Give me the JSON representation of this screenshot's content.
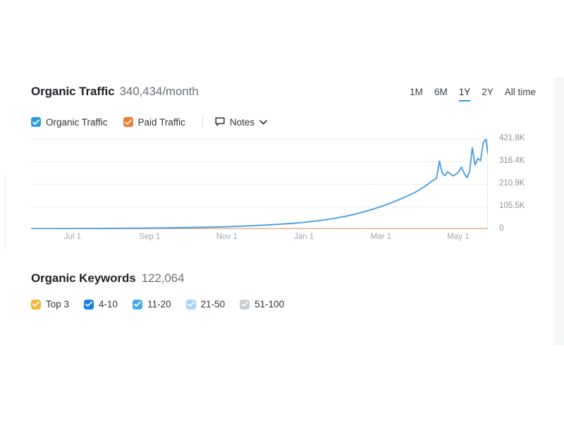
{
  "header": {
    "title": "Organic Traffic",
    "value": "340,434/month"
  },
  "time_ranges": [
    {
      "label": "1M",
      "active": false
    },
    {
      "label": "6M",
      "active": false
    },
    {
      "label": "1Y",
      "active": true
    },
    {
      "label": "2Y",
      "active": false
    },
    {
      "label": "All time",
      "active": false
    }
  ],
  "traffic_legend": [
    {
      "label": "Organic Traffic",
      "checked": true,
      "color": "#2d9cdb"
    },
    {
      "label": "Paid Traffic",
      "checked": true,
      "color": "#ef7c35"
    }
  ],
  "notes": {
    "label": "Notes",
    "icon": "note-bubble-icon",
    "chevron": "chevron-down-icon"
  },
  "keywords": {
    "title": "Organic Keywords",
    "value": "122,064",
    "buckets": [
      {
        "label": "Top 3",
        "checked": true,
        "color": "#f5b63f"
      },
      {
        "label": "4-10",
        "checked": true,
        "color": "#1a7fe0"
      },
      {
        "label": "11-20",
        "checked": true,
        "color": "#4aa9ec"
      },
      {
        "label": "21-50",
        "checked": true,
        "color": "#a8d5f5"
      },
      {
        "label": "51-100",
        "checked": true,
        "color": "#c8cdd2"
      }
    ]
  },
  "accent_color": "#2d9cdb",
  "chart_data": {
    "type": "line",
    "title": "Organic Traffic",
    "xlabel": "",
    "ylabel": "",
    "grid": true,
    "legend_position": "top-left",
    "ylim": [
      0,
      421800
    ],
    "ytick_labels": [
      "421.8K",
      "316.4K",
      "210.9K",
      "105.5K",
      "0"
    ],
    "ytick_values": [
      421800,
      316400,
      210900,
      105500,
      0
    ],
    "xtick_labels": [
      "Jul 1",
      "Sep 1",
      "Nov 1",
      "Jan 1",
      "Mar 1",
      "May 1"
    ],
    "xtick_positions": [
      0.0909,
      0.2597,
      0.4286,
      0.5974,
      0.7662,
      0.9351
    ],
    "series": [
      {
        "name": "Organic Traffic",
        "color": "#4a9fe0",
        "x": [
          0,
          0.012,
          0.024,
          0.036,
          0.048,
          0.06,
          0.072,
          0.084,
          0.096,
          0.108,
          0.12,
          0.132,
          0.144,
          0.156,
          0.168,
          0.18,
          0.192,
          0.204,
          0.216,
          0.228,
          0.24,
          0.252,
          0.264,
          0.276,
          0.288,
          0.3,
          0.312,
          0.324,
          0.336,
          0.348,
          0.36,
          0.372,
          0.384,
          0.396,
          0.408,
          0.42,
          0.432,
          0.444,
          0.456,
          0.468,
          0.48,
          0.492,
          0.504,
          0.516,
          0.528,
          0.54,
          0.552,
          0.564,
          0.576,
          0.588,
          0.6,
          0.612,
          0.624,
          0.636,
          0.648,
          0.66,
          0.672,
          0.684,
          0.696,
          0.708,
          0.72,
          0.732,
          0.744,
          0.756,
          0.768,
          0.78,
          0.792,
          0.804,
          0.816,
          0.828,
          0.836,
          0.844,
          0.852,
          0.86,
          0.868,
          0.876,
          0.882,
          0.888,
          0.894,
          0.9,
          0.906,
          0.912,
          0.918,
          0.924,
          0.93,
          0.936,
          0.942,
          0.948,
          0.954,
          0.96,
          0.966,
          0.972,
          0.978,
          0.984,
          0.99,
          0.996,
          1.0
        ],
        "values": [
          1800,
          1900,
          2000,
          2100,
          2000,
          2200,
          2300,
          2400,
          2500,
          2600,
          2700,
          2900,
          3000,
          3200,
          3300,
          3500,
          3600,
          3800,
          4000,
          4200,
          4400,
          4600,
          4900,
          5200,
          5500,
          5800,
          6200,
          6600,
          7000,
          7400,
          7900,
          8400,
          9000,
          9600,
          10300,
          11000,
          11800,
          12600,
          13500,
          14500,
          15600,
          16800,
          18000,
          19300,
          20700,
          22300,
          24000,
          25800,
          27800,
          30000,
          32500,
          35200,
          38200,
          41400,
          45000,
          49000,
          53400,
          58200,
          63500,
          69500,
          76000,
          83000,
          90500,
          98500,
          107000,
          116000,
          126000,
          136500,
          147500,
          159000,
          167000,
          176000,
          186000,
          197000,
          209000,
          222000,
          230000,
          239000,
          318000,
          262000,
          250000,
          268000,
          258000,
          249000,
          256000,
          268000,
          290000,
          262000,
          240000,
          268000,
          380000,
          300000,
          330000,
          320000,
          405000,
          420000,
          352000
        ],
        "peak_value": 421800,
        "end_value": 340434
      },
      {
        "name": "Paid Traffic",
        "color": "#e8b896",
        "x": [
          0,
          0.25,
          0.5,
          0.75,
          1.0
        ],
        "values": [
          0,
          0,
          0,
          0,
          0
        ]
      }
    ]
  }
}
